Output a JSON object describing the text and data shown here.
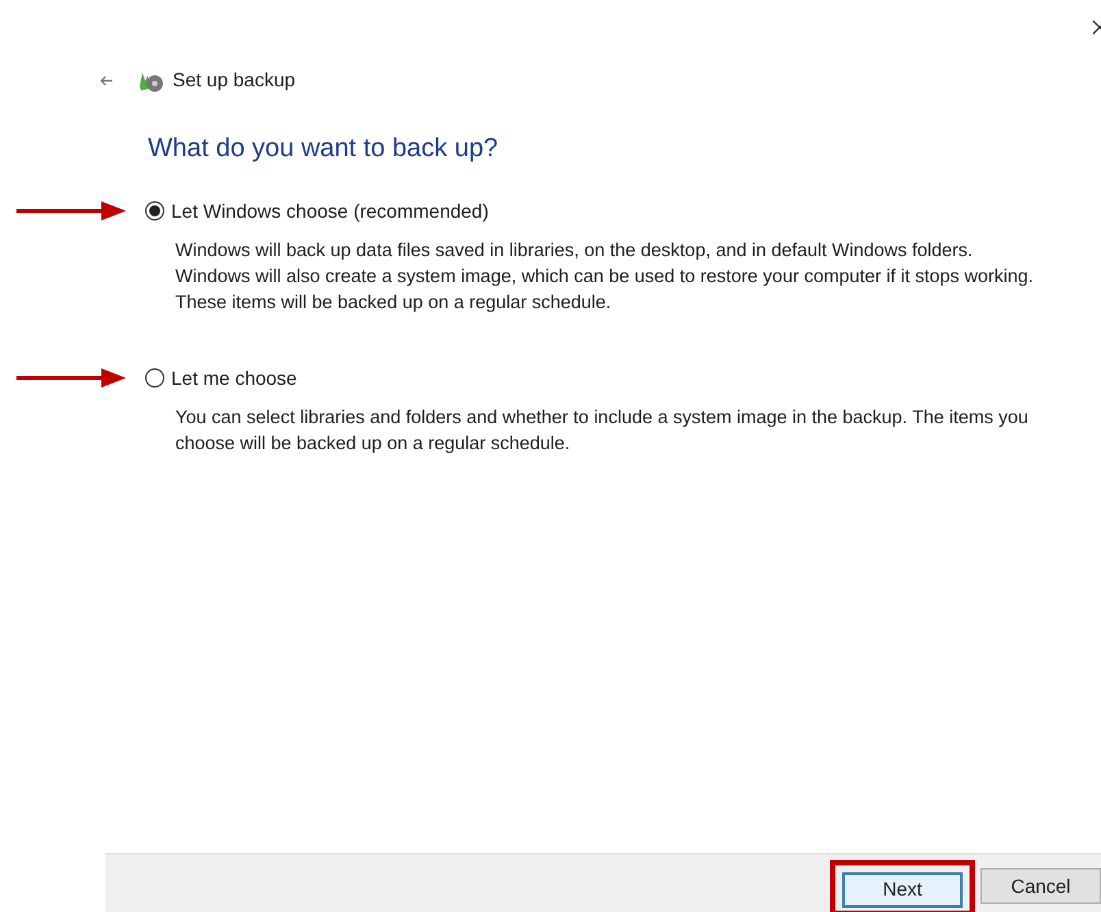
{
  "window": {
    "title": "Set up backup"
  },
  "heading": "What do you want to back up?",
  "options": [
    {
      "label": "Let Windows choose (recommended)",
      "selected": true,
      "description": "Windows will back up data files saved in libraries, on the desktop, and in default Windows folders. Windows will also create a system image, which can be used to restore your computer if it stops working. These items will be backed up on a regular schedule."
    },
    {
      "label": "Let me choose",
      "selected": false,
      "description": "You can select libraries and folders and whether to include a system image in the backup. The items you choose will be backed up on a regular schedule."
    }
  ],
  "buttons": [
    {
      "label": "Next",
      "highlighted": true
    },
    {
      "label": "Cancel",
      "highlighted": false
    }
  ]
}
